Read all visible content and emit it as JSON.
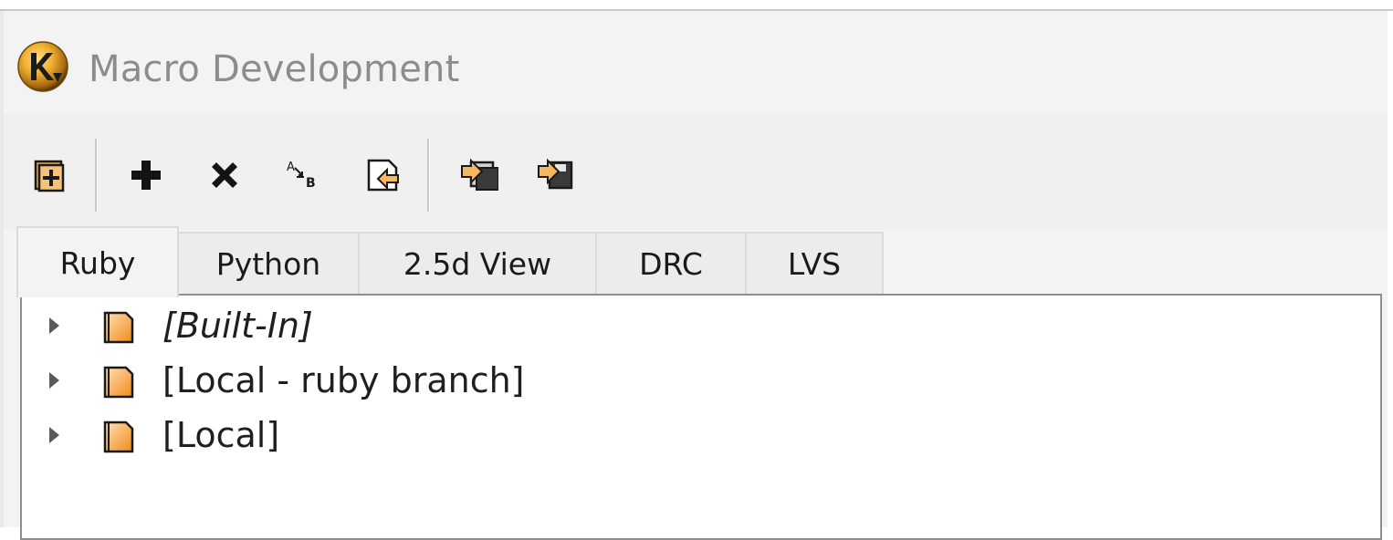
{
  "window": {
    "title": "Macro Development",
    "logo_icon": "klayout-logo-icon"
  },
  "toolbar": {
    "buttons": [
      {
        "name": "new-folder-button",
        "icon": "new-folder-icon"
      },
      {
        "name": "add-button",
        "icon": "plus-icon"
      },
      {
        "name": "delete-button",
        "icon": "close-icon"
      },
      {
        "name": "rename-button",
        "icon": "rename-icon"
      },
      {
        "name": "import-button",
        "icon": "import-icon"
      },
      {
        "name": "save-all-button",
        "icon": "save-all-icon"
      },
      {
        "name": "save-as-button",
        "icon": "save-as-icon"
      }
    ]
  },
  "tabs": [
    {
      "label": "Ruby",
      "active": true
    },
    {
      "label": "Python",
      "active": false
    },
    {
      "label": "2.5d View",
      "active": false
    },
    {
      "label": "DRC",
      "active": false
    },
    {
      "label": "LVS",
      "active": false
    }
  ],
  "tree": {
    "items": [
      {
        "label": "[Built-In]",
        "italic": true,
        "expanded": false,
        "icon": "folder-icon"
      },
      {
        "label": "[Local - ruby branch]",
        "italic": false,
        "expanded": false,
        "icon": "folder-icon"
      },
      {
        "label": "[Local]",
        "italic": false,
        "expanded": false,
        "icon": "folder-icon"
      }
    ]
  },
  "colors": {
    "folder_fill_top": "#ffe1b8",
    "folder_fill_bottom": "#f08a18",
    "title_text": "#8c8c8c",
    "window_bg": "#f3f3f3"
  }
}
